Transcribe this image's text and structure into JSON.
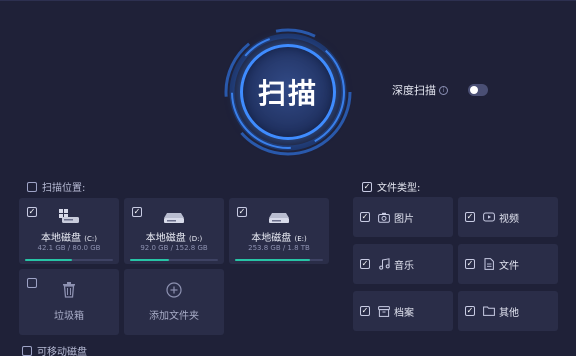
{
  "scan": {
    "label": "扫描"
  },
  "deep_scan": {
    "label": "深度扫描",
    "info": "i",
    "enabled": false
  },
  "scan_location": {
    "title": "扫描位置:",
    "checked": false,
    "drives": [
      {
        "name": "本地磁盘",
        "letter": "(C:)",
        "size": "42.1 GB / 80.0 GB",
        "checked": true,
        "usage": 0.53
      },
      {
        "name": "本地磁盘",
        "letter": "(D:)",
        "size": "92.0 GB / 152.8 GB",
        "checked": true,
        "usage": 0.44
      },
      {
        "name": "本地磁盘",
        "letter": "(E:)",
        "size": "253.8 GB / 1.8 TB",
        "checked": true,
        "usage": 0.85
      }
    ],
    "recycle_bin": {
      "label": "垃圾箱",
      "checked": false
    },
    "add_folder": {
      "label": "添加文件夹"
    }
  },
  "file_types": {
    "title": "文件类型:",
    "checked": true,
    "items": [
      {
        "label": "图片",
        "icon": "camera-icon",
        "checked": true
      },
      {
        "label": "视频",
        "icon": "video-icon",
        "checked": true
      },
      {
        "label": "音乐",
        "icon": "music-icon",
        "checked": true
      },
      {
        "label": "文件",
        "icon": "document-icon",
        "checked": true
      },
      {
        "label": "档案",
        "icon": "archive-icon",
        "checked": true
      },
      {
        "label": "其他",
        "icon": "folder-icon",
        "checked": true
      }
    ]
  },
  "removable": {
    "title": "可移动磁盘",
    "checked": false
  },
  "colors": {
    "accent": "#3f8cff",
    "progress": "#27c4a6",
    "background": "#1f2138",
    "card": "#2a2d48"
  }
}
